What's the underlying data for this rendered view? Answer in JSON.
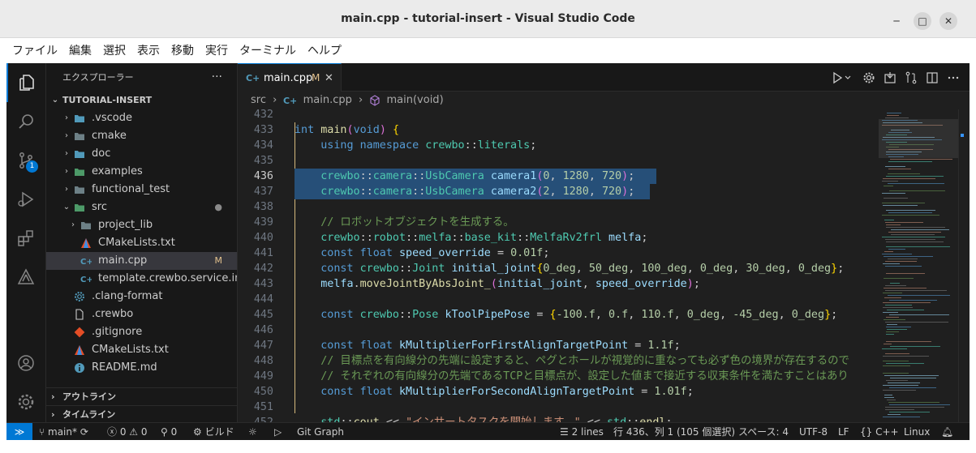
{
  "window": {
    "title": "main.cpp - tutorial-insert - Visual Studio Code",
    "minimize_glyph": "─",
    "maximize_glyph": "□",
    "close_glyph": "✕"
  },
  "menu": [
    "ファイル",
    "編集",
    "選択",
    "表示",
    "移動",
    "実行",
    "ターミナル",
    "ヘルプ"
  ],
  "activity_bar": {
    "items": [
      "files-icon",
      "search-icon",
      "source-control-icon",
      "run-debug-icon",
      "extensions-icon",
      "test-icon"
    ],
    "scm_badge": "1",
    "bottom": [
      "account-icon",
      "settings-gear-icon"
    ]
  },
  "sidebar": {
    "header": "エクスプローラー",
    "more": "···",
    "root": "TUTORIAL-INSERT",
    "items": [
      {
        "label": "vscode",
        "dotted": ".vscode",
        "type": "folder",
        "depth": 1,
        "chevron": "›",
        "icon_color": "#519aba"
      },
      {
        "label": "cmake",
        "type": "folder",
        "depth": 1,
        "chevron": "›",
        "icon_color": "#6d8086"
      },
      {
        "label": "doc",
        "type": "folder",
        "depth": 1,
        "chevron": "›",
        "icon_color": "#519aba"
      },
      {
        "label": "examples",
        "type": "folder",
        "depth": 1,
        "chevron": "›",
        "icon_color": "#4d9a68"
      },
      {
        "label": "functional_test",
        "type": "folder",
        "depth": 1,
        "chevron": "›",
        "icon_color": "#6d8086"
      },
      {
        "label": "src",
        "type": "folder",
        "depth": 1,
        "chevron": "⌄",
        "icon_color": "#4d9a68",
        "decoration": "●"
      },
      {
        "label": "project_lib",
        "type": "folder",
        "depth": 2,
        "chevron": "›",
        "icon_color": "#6d8086"
      },
      {
        "label": "CMakeLists.txt",
        "type": "cmake",
        "depth": 2
      },
      {
        "label": "main.cpp",
        "type": "cpp",
        "depth": 2,
        "decoration": "M",
        "selected": true
      },
      {
        "label": "template.crewbo.service.in",
        "type": "cpp",
        "depth": 2
      },
      {
        "label": ".clang-format",
        "type": "gear",
        "depth": 1
      },
      {
        "label": ".crewbo",
        "type": "file",
        "depth": 1
      },
      {
        "label": ".gitignore",
        "type": "git",
        "depth": 1
      },
      {
        "label": "CMakeLists.txt",
        "type": "cmake",
        "depth": 1
      },
      {
        "label": "README.md",
        "type": "info",
        "depth": 1
      }
    ],
    "outline": "アウトライン",
    "timeline": "タイムライン"
  },
  "editor": {
    "tab": {
      "label": "main.cpp",
      "modified": "M",
      "close": "✕"
    },
    "breadcrumb": {
      "folder": "src",
      "file": "main.cpp",
      "symbol": "main(void)",
      "sep": "›"
    },
    "current_line": 436,
    "lines": [
      {
        "n": "432",
        "text": ""
      },
      {
        "n": "433",
        "text": "int main(void) {"
      },
      {
        "n": "434",
        "text": "    using namespace crewbo::literals;"
      },
      {
        "n": "435",
        "text": ""
      },
      {
        "n": "436",
        "text": "    crewbo::camera::UsbCamera camera1(0, 1280, 720);"
      },
      {
        "n": "437",
        "text": "    crewbo::camera::UsbCamera camera2(2, 1280, 720);"
      },
      {
        "n": "438",
        "text": ""
      },
      {
        "n": "439",
        "text": "    // ロボットオブジェクトを生成する。"
      },
      {
        "n": "440",
        "text": "    crewbo::robot::melfa::base_kit::MelfaRv2frl melfa;"
      },
      {
        "n": "441",
        "text": "    const float speed_override = 0.01f;"
      },
      {
        "n": "442",
        "text": "    const crewbo::Joint initial_joint{0_deg, 50_deg, 100_deg, 0_deg, 30_deg, 0_deg};"
      },
      {
        "n": "443",
        "text": "    melfa.moveJointByAbsJoint_(initial_joint, speed_override);"
      },
      {
        "n": "444",
        "text": ""
      },
      {
        "n": "445",
        "text": "    const crewbo::Pose kToolPipePose = {-100.f, 0.f, 110.f, 0_deg, -45_deg, 0_deg};"
      },
      {
        "n": "446",
        "text": ""
      },
      {
        "n": "447",
        "text": "    const float kMultiplierForFirstAlignTargetPoint = 1.1f;"
      },
      {
        "n": "448",
        "text": "    // 目標点を有向線分の先端に設定すると、ペグとホールが視覚的に重なっても必ず色の境界が存在するので"
      },
      {
        "n": "449",
        "text": "    // それぞれの有向線分の先端であるTCPと目標点が、設定した値まで接近する収束条件を満たすことはあり"
      },
      {
        "n": "450",
        "text": "    const float kMultiplierForSecondAlignTargetPoint = 1.01f;"
      },
      {
        "n": "451",
        "text": ""
      },
      {
        "n": "452",
        "text": "    std::cout << \"インサートタスクを開始します。\" << std::endl;"
      }
    ]
  },
  "status": {
    "branch": "main*",
    "errors": "0",
    "warnings": "0",
    "ports": "0",
    "build": "ビルド",
    "git_graph": "Git Graph",
    "lines_selected": "2 lines",
    "position": "行 436、列 1 (105 個選択)",
    "spaces": "スペース: 4",
    "encoding": "UTF-8",
    "eol": "LF",
    "language": "C++",
    "platform": "Linux"
  },
  "colors": {
    "accent": "#0078d4",
    "selection": "#264f78",
    "modified": "#e2c08d",
    "editor_bg": "#1f1f1f",
    "sidebar_bg": "#181818"
  }
}
